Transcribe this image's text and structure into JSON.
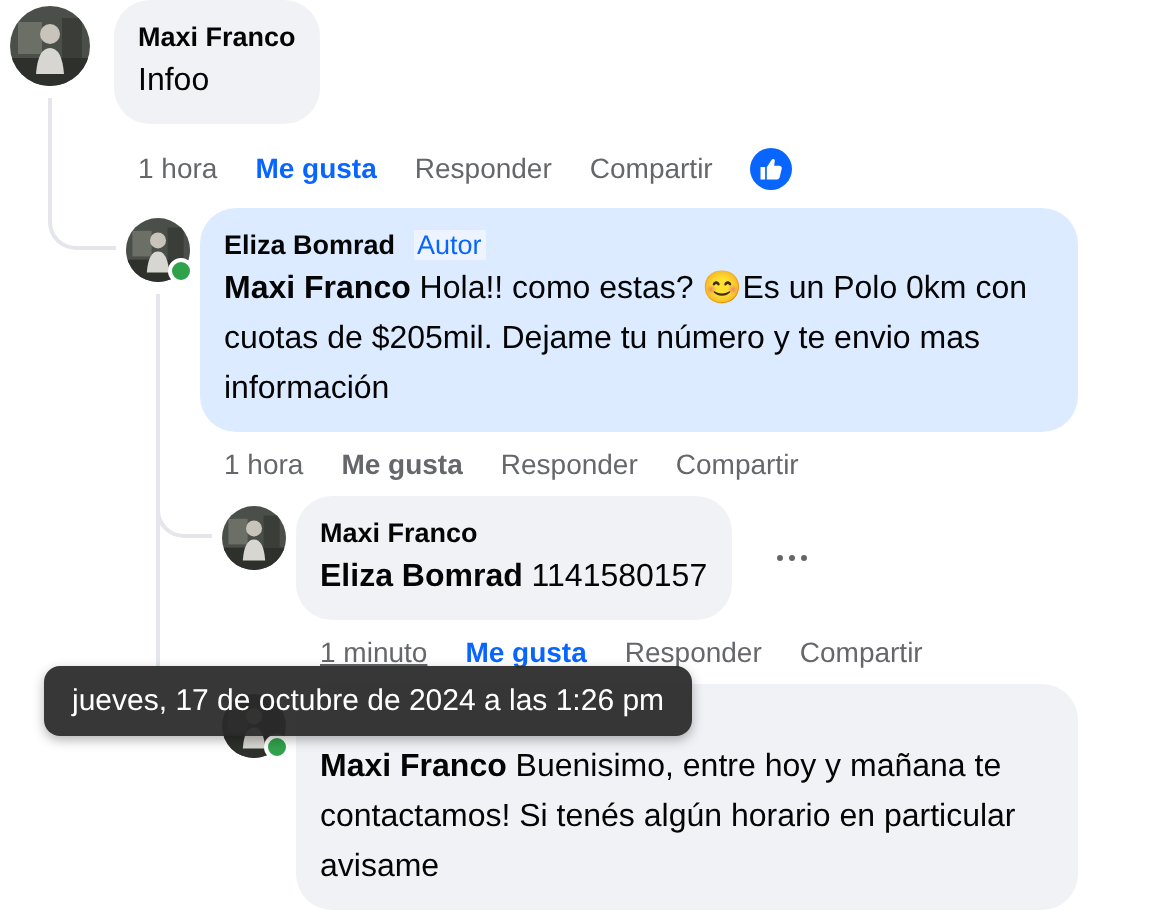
{
  "comments": [
    {
      "author": "Maxi Franco",
      "online": false,
      "highlighted": false,
      "text": "Infoo",
      "time": "1 hora",
      "time_hovered": false,
      "like": "Me gusta",
      "liked": true,
      "reply": "Responder",
      "share": "Compartir",
      "reactions": [
        {
          "kind": "like"
        }
      ],
      "replies": [
        {
          "author": "Eliza Bomrad",
          "badge": "Autor",
          "online": true,
          "highlighted": true,
          "text": "**Maxi Franco** Hola!! como estas? 😊Es un Polo 0km con cuotas de $205mil. Dejame tu número y te envio mas información",
          "time": "1 hora",
          "time_hovered": false,
          "like": "Me gusta",
          "liked": false,
          "reply": "Responder",
          "share": "Compartir",
          "replies": [
            {
              "author": "Maxi Franco",
              "online": false,
              "highlighted": false,
              "text": "**Eliza Bomrad** 1141580157",
              "time": "1 minuto",
              "time_hovered": true,
              "like": "Me gusta",
              "liked": true,
              "reply": "Responder",
              "share": "Compartir",
              "menu_visible": true
            },
            {
              "online": true,
              "highlighted": false,
              "text": "**Maxi Franco** Buenisimo, entre hoy y mañana te contactamos! Si tenés algún horario en particular avisame"
            }
          ]
        }
      ]
    }
  ],
  "tooltip": {
    "text": "jueves, 17 de octubre de 2024 a las 1:26 pm"
  }
}
